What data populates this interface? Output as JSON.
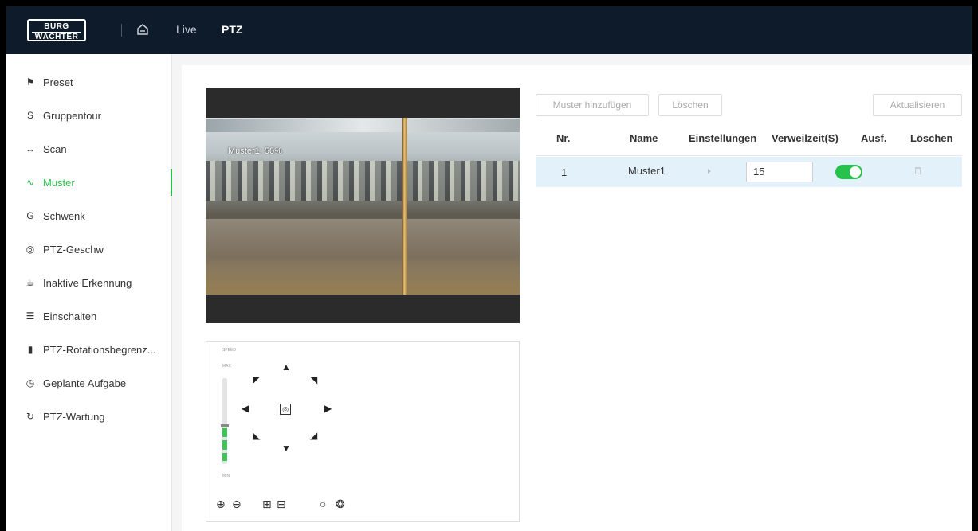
{
  "header": {
    "logo_top": "BURG",
    "logo_bottom": "WÄCHTER",
    "nav": [
      {
        "label": "Live"
      },
      {
        "label": "PTZ"
      }
    ]
  },
  "sidebar": {
    "active_color": "#27c24c",
    "items": [
      {
        "label": "Preset",
        "icon": "preset-icon"
      },
      {
        "label": "Gruppentour",
        "icon": "group-tour-icon"
      },
      {
        "label": "Scan",
        "icon": "scan-icon"
      },
      {
        "label": "Muster",
        "icon": "pattern-icon"
      },
      {
        "label": "Schwenk",
        "icon": "pan-icon"
      },
      {
        "label": "PTZ-Geschw",
        "icon": "speed-icon"
      },
      {
        "label": "Inaktive Erkennung",
        "icon": "idle-icon"
      },
      {
        "label": "Einschalten",
        "icon": "power-on-icon"
      },
      {
        "label": "PTZ-Rotationsbegrenz...",
        "icon": "rotation-limit-icon"
      },
      {
        "label": "Geplante Aufgabe",
        "icon": "schedule-icon"
      },
      {
        "label": "PTZ-Wartung",
        "icon": "maintenance-icon"
      }
    ]
  },
  "video": {
    "osd_text": "Muster1: 50%"
  },
  "ptz_control": {
    "speed_label": "SPEED",
    "max_label": "MAX",
    "min_label": "MIN",
    "speed_level": 0.4
  },
  "toolbar": {
    "add_label": "Muster hinzufügen",
    "delete_label": "Löschen",
    "refresh_label": "Aktualisieren"
  },
  "table": {
    "columns": [
      "Nr.",
      "Name",
      "Einstellungen",
      "Verweilzeit(S)",
      "Ausf.",
      "Löschen"
    ],
    "rows": [
      {
        "nr": "1",
        "name": "Muster1",
        "dwell": "15",
        "enabled": true
      }
    ]
  }
}
